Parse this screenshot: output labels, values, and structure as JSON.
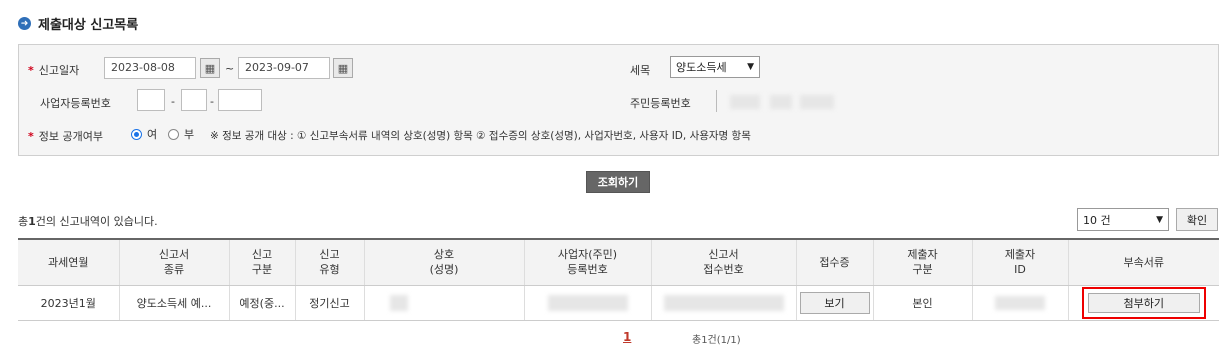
{
  "section": {
    "title": "제출대상 신고목록",
    "icon": "arrow-circle-icon"
  },
  "form": {
    "report_date_label": "신고일자",
    "date_from": "2023-08-08",
    "date_sep": "~",
    "date_to": "2023-09-07",
    "tax_item_label": "세목",
    "tax_item_value": "양도소득세",
    "biz_no_label": "사업자등록번호",
    "biz_sep": "-",
    "resident_no_label": "주민등록번호",
    "disclosure_label": "정보 공개여부",
    "opt_yes": "여",
    "opt_no": "부",
    "disclosure_note": "※ 정보 공개 대상 : ① 신고부속서류 내역의 상호(성명) 항목 ② 접수증의 상호(성명), 사업자번호, 사용자 ID, 사용자명 항목"
  },
  "search_button": "조회하기",
  "summary": {
    "prefix": "총",
    "count": "1",
    "suffix": "건의 신고내역이 있습니다."
  },
  "page_size": {
    "value": "10 건",
    "confirm": "확인"
  },
  "table": {
    "headers": [
      "과세연월",
      "신고서\n종류",
      "신고\n구분",
      "신고\n유형",
      "상호\n(성명)",
      "사업자(주민)\n등록번호",
      "신고서\n접수번호",
      "접수증",
      "제출자\n구분",
      "제출자\nID",
      "부속서류"
    ],
    "rows": [
      {
        "period": "2023년1월",
        "form_type": "양도소득세 예...",
        "category": "예정(중...",
        "type": "정기신고",
        "receipt_btn": "보기",
        "submitter_type": "본인",
        "attach_btn": "첨부하기"
      }
    ]
  },
  "pager": {
    "current": "1",
    "info": "총1건(1/1)"
  },
  "colors": {
    "accent": "#2f6fb8",
    "required": "#d0021b",
    "highlight": "#e00000"
  }
}
